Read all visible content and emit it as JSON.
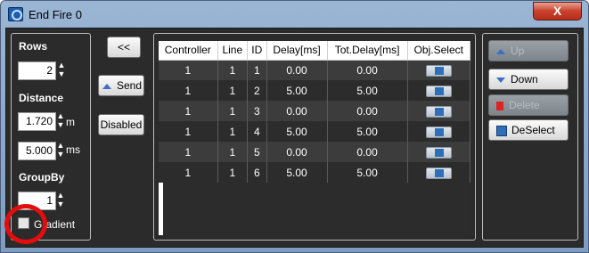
{
  "window": {
    "title": "End Fire 0",
    "close_label": "X"
  },
  "left_panel": {
    "rows_label": "Rows",
    "rows_value": "2",
    "distance_label": "Distance",
    "distance_value": "1.720",
    "distance_unit": "m",
    "delay_value": "5.000",
    "delay_unit": "ms",
    "groupby_label": "GroupBy",
    "groupby_value": "1",
    "gradient_label": "Gradient"
  },
  "mid_buttons": {
    "collapse_label": "<<",
    "send_label": "Send",
    "disabled_label": "Disabled"
  },
  "table": {
    "headers": [
      "Controller",
      "Line",
      "ID",
      "Delay[ms]",
      "Tot.Delay[ms]",
      "Obj.Select"
    ],
    "rows": [
      {
        "controller": "1",
        "line": "1",
        "id": "1",
        "delay": "0.00",
        "tot_delay": "0.00"
      },
      {
        "controller": "1",
        "line": "1",
        "id": "2",
        "delay": "5.00",
        "tot_delay": "5.00"
      },
      {
        "controller": "1",
        "line": "1",
        "id": "3",
        "delay": "0.00",
        "tot_delay": "0.00"
      },
      {
        "controller": "1",
        "line": "1",
        "id": "4",
        "delay": "5.00",
        "tot_delay": "5.00"
      },
      {
        "controller": "1",
        "line": "1",
        "id": "5",
        "delay": "0.00",
        "tot_delay": "0.00"
      },
      {
        "controller": "1",
        "line": "1",
        "id": "6",
        "delay": "5.00",
        "tot_delay": "5.00"
      }
    ]
  },
  "right_panel": {
    "up_label": "Up",
    "down_label": "Down",
    "delete_label": "Delete",
    "deselect_label": "DeSelect"
  }
}
